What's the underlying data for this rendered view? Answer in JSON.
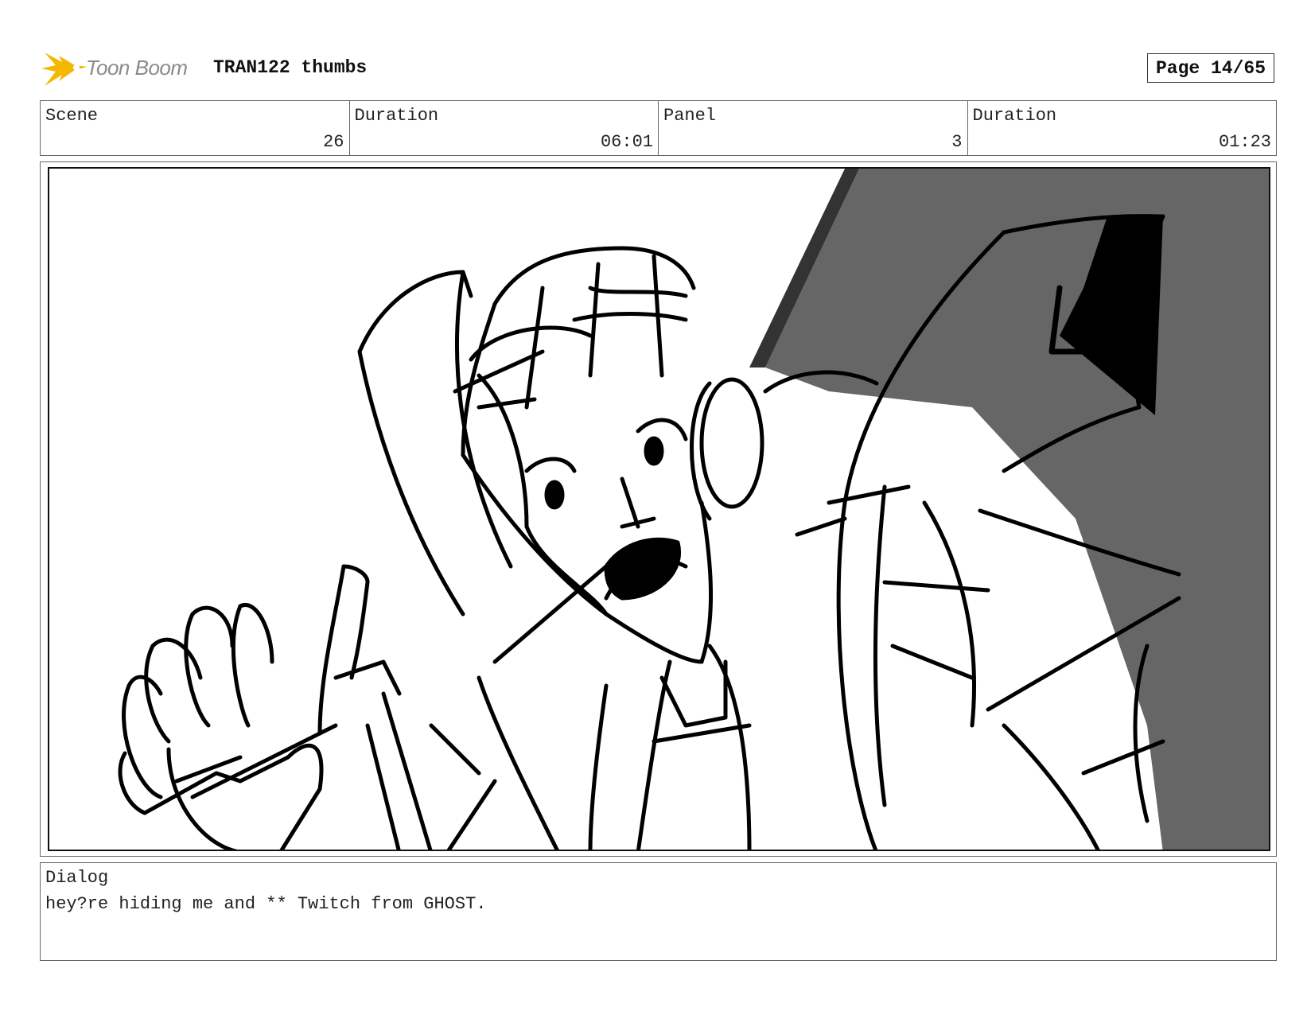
{
  "header": {
    "logo_text": "Toon Boom",
    "document_title": "TRAN122 thumbs",
    "page_indicator": "Page 14/65"
  },
  "info": {
    "scene_label": "Scene",
    "scene_value": "26",
    "scene_duration_label": "Duration",
    "scene_duration_value": "06:01",
    "panel_label": "Panel",
    "panel_value": "3",
    "panel_duration_label": "Duration",
    "panel_duration_value": "01:23"
  },
  "dialog": {
    "label": "Dialog",
    "text": "hey?re hiding me and ** Twitch from GHOST."
  },
  "colors": {
    "logo_flash": "#f5b800",
    "logo_text": "#8a8a8a",
    "background_fill": "#666666",
    "ink": "#000000"
  }
}
